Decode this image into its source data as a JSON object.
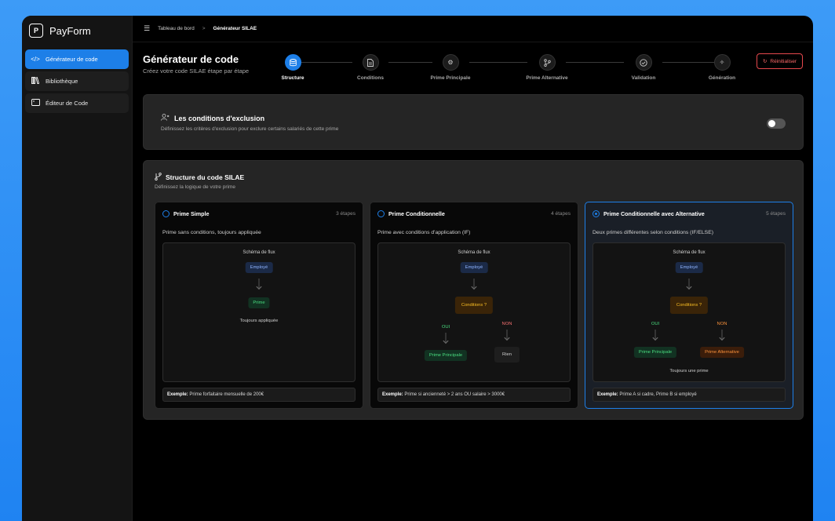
{
  "app": {
    "name": "PayForm"
  },
  "sidebar": {
    "items": [
      {
        "label": "Générateur de code",
        "icon": "code-icon"
      },
      {
        "label": "Bibliothèque",
        "icon": "library-icon"
      },
      {
        "label": "Éditeur de Code",
        "icon": "editor-icon"
      }
    ]
  },
  "breadcrumb": {
    "home": "Tableau de bord",
    "separator": ">",
    "current": "Générateur SILAE"
  },
  "header": {
    "title": "Générateur de code",
    "subtitle": "Créez votre code SILAE étape par étape",
    "reset_label": "Réinitialiser"
  },
  "stepper": {
    "active": 0,
    "steps": [
      {
        "label": "Structure",
        "icon": "database-icon"
      },
      {
        "label": "Conditions",
        "icon": "document-icon"
      },
      {
        "label": "Prime Principale",
        "icon": "settings-icon"
      },
      {
        "label": "Prime Alternative",
        "icon": "branch-icon"
      },
      {
        "label": "Validation",
        "icon": "check-circle-icon"
      },
      {
        "label": "Génération",
        "icon": "sparkles-icon"
      }
    ]
  },
  "exclusion": {
    "title": "Les conditions d'exclusion",
    "description": "Définissez les critères d'exclusion pour exclure certains salariés de cette prime",
    "enabled": false
  },
  "structure": {
    "title": "Structure du code SILAE",
    "description": "Définissez la logique de votre prime",
    "cards": [
      {
        "title": "Prime Simple",
        "steps": "3 étapes",
        "selected": false,
        "description": "Prime sans conditions, toujours appliquée",
        "flow_title": "Schéma de flux",
        "nodes": {
          "employee": "Employé",
          "prime": "Prime",
          "footer": "Toujours appliquée"
        },
        "example_label": "Exemple:",
        "example_text": "Prime forfaitaire mensuelle de 200€"
      },
      {
        "title": "Prime Conditionnelle",
        "steps": "4 étapes",
        "selected": false,
        "description": "Prime avec conditions d'application (IF)",
        "flow_title": "Schéma de flux",
        "nodes": {
          "employee": "Employé",
          "condition": "Conditions ?",
          "yes": "OUI",
          "no": "NON",
          "main": "Prime Principale",
          "none": "Rien"
        },
        "example_label": "Exemple:",
        "example_text": "Prime si ancienneté > 2 ans OU salaire > 3000€"
      },
      {
        "title": "Prime Conditionnelle avec Alternative",
        "steps": "5 étapes",
        "selected": true,
        "description": "Deux primes différentes selon conditions (IF/ELSE)",
        "flow_title": "Schéma de flux",
        "nodes": {
          "employee": "Employé",
          "condition": "Conditions ?",
          "yes": "OUI",
          "no": "NON",
          "main": "Prime Principale",
          "alternative": "Prime Alternative",
          "footer": "Toujours une prime"
        },
        "example_label": "Exemple:",
        "example_text": "Prime A si cadre, Prime B si employé"
      }
    ]
  },
  "colors": {
    "accent": "#1d7fe8",
    "danger": "#e5484d",
    "success": "#4ade80",
    "warning": "#fbbf24"
  }
}
